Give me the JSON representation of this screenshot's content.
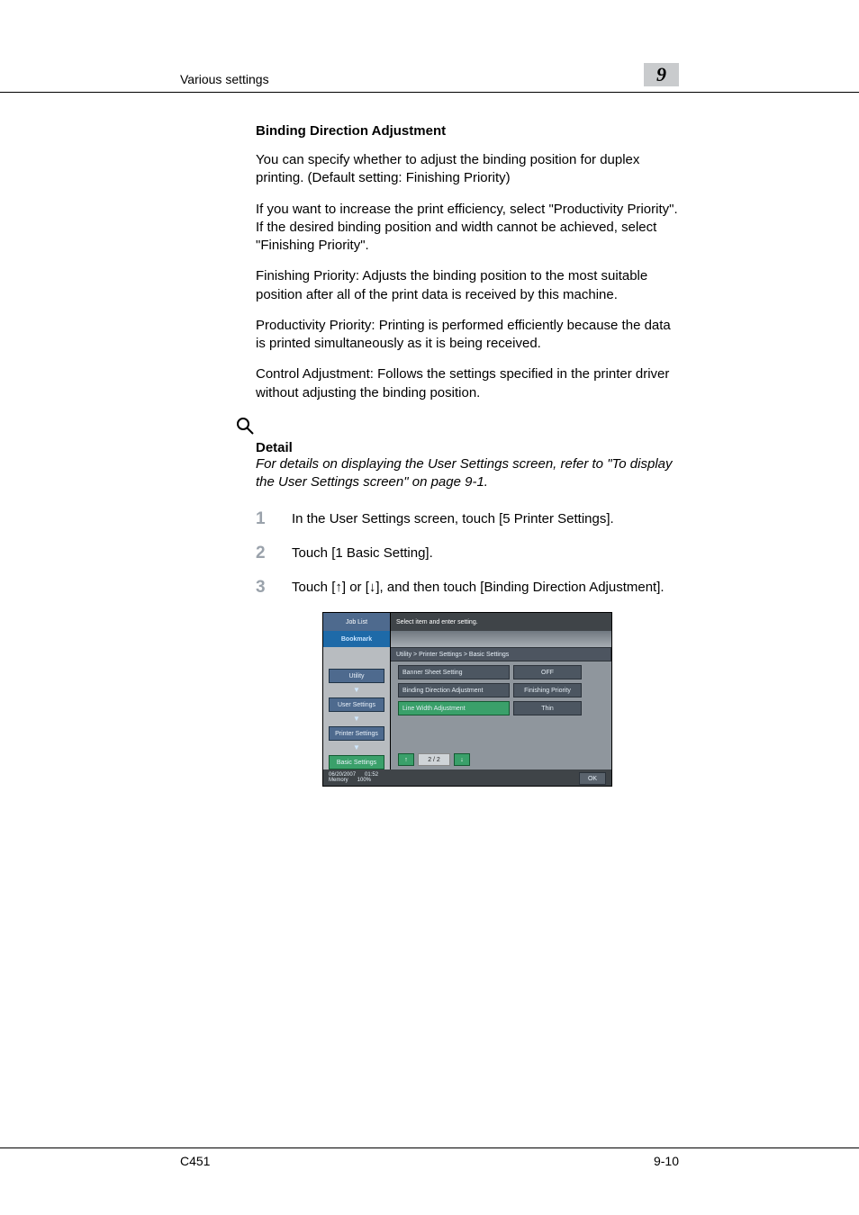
{
  "header": {
    "section": "Various settings",
    "chapter": "9"
  },
  "section_title": "Binding Direction Adjustment",
  "paragraphs": {
    "p1": "You can specify whether to adjust the binding position for duplex printing. (Default setting: Finishing Priority)",
    "p2": "If you want to increase the print efficiency, select \"Productivity Priority\". If the desired binding position and width cannot be achieved, select \"Finishing Priority\".",
    "p3": "Finishing Priority: Adjusts the binding position to the most suitable position after all of the print data is received by this machine.",
    "p4": "Productivity Priority: Printing is performed efficiently because the data is printed simultaneously as it is being received.",
    "p5": "Control Adjustment: Follows the settings specified in the printer driver without adjusting the binding position."
  },
  "detail": {
    "label": "Detail",
    "text": "For details on displaying the User Settings screen, refer to \"To display the User Settings screen\" on page 9-1."
  },
  "steps": [
    {
      "n": "1",
      "t": "In the User Settings screen, touch [5 Printer Settings]."
    },
    {
      "n": "2",
      "t": "Touch [1 Basic Setting]."
    },
    {
      "n": "3",
      "t": "Touch [↑] or [↓], and then touch [Binding Direction Adjustment]."
    }
  ],
  "screenshot": {
    "job_list": "Job List",
    "instruction": "Select item and enter setting.",
    "bookmark": "Bookmark",
    "breadcrumb": "Utility > Printer Settings > Basic Settings",
    "sidebar": [
      {
        "label": "Utility",
        "active": false
      },
      {
        "label": "User Settings",
        "active": false
      },
      {
        "label": "Printer Settings",
        "active": false
      },
      {
        "label": "Basic Settings",
        "active": true
      }
    ],
    "rows": [
      {
        "label": "Banner Sheet Setting",
        "value": "OFF",
        "active": false
      },
      {
        "label": "Binding Direction Adjustment",
        "value": "Finishing Priority",
        "active": false
      },
      {
        "label": "Line Width Adjustment",
        "value": "Thin",
        "active": true
      }
    ],
    "pager": "2 / 2",
    "status": {
      "date": "06/20/2007",
      "time": "01:52",
      "mem_label": "Memory",
      "mem_value": "100%"
    },
    "ok": "OK"
  },
  "footer": {
    "model": "C451",
    "page": "9-10"
  }
}
